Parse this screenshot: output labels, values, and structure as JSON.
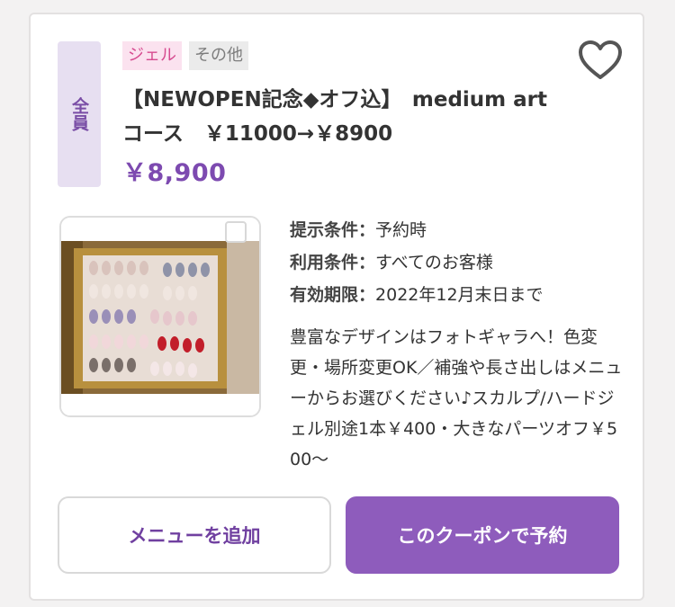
{
  "coupon": {
    "target": "全員",
    "tags": [
      "ジェル",
      "その他"
    ],
    "title": "【NEWOPEN記念◆オフ込】　medium art コース　￥11000→￥8900",
    "price": "￥8,900",
    "conditions": [
      {
        "label": "提示条件：",
        "value": "予約時"
      },
      {
        "label": "利用条件：",
        "value": "すべてのお客様"
      },
      {
        "label": "有効期限：",
        "value": "2022年12月末日まで"
      }
    ],
    "description": "豊富なデザインはフォトギャラへ！色変更・場所変更OK／補強や長さ出しはメニューからお選びください♪スカルプ/ハードジェル別途1本￥400・大きなパーツオフ￥500〜",
    "photo_icon": "nail-sample-photo",
    "favorite_icon": "heart-icon"
  },
  "buttons": {
    "add_menu": "メニューを追加",
    "reserve": "このクーポンで予約"
  },
  "colors": {
    "accent": "#8e5cbc",
    "price": "#7d4ab0",
    "badge_bg": "#e7dff1",
    "tag_gel_bg": "#fbe2ef",
    "tag_gel_text": "#d64a8f"
  }
}
